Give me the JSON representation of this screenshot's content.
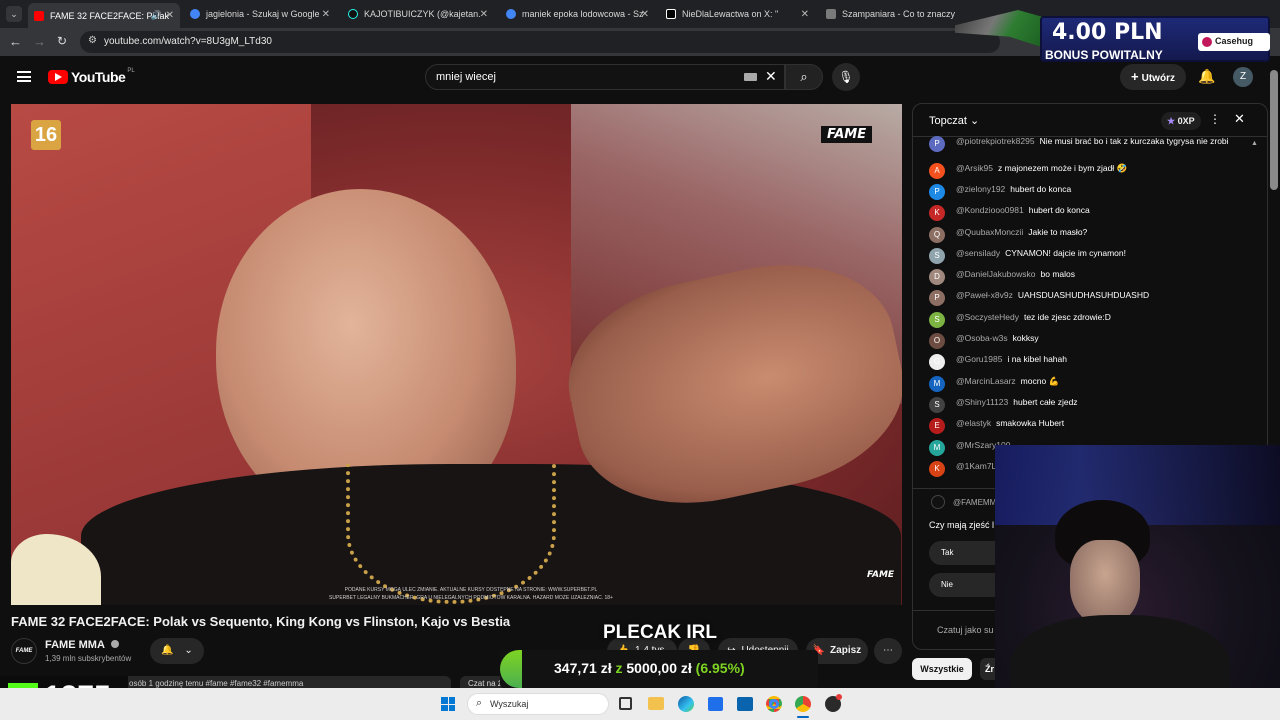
{
  "browser": {
    "tabs": [
      {
        "label": "FAME 32 FACE2FACE: Polak",
        "color": "#ff0000"
      },
      {
        "label": "jagielonia - Szukaj w Google",
        "color": "#4285f4"
      },
      {
        "label": "KAJOTIBUICZYK (@kajetan.szczz",
        "color": "#111111"
      },
      {
        "label": "maniek epoka lodowcowa - Sz",
        "color": "#4285f4"
      },
      {
        "label": "NieDlaLewactwa on X: \"",
        "color": "#000000"
      },
      {
        "label": "Szampaniara - Co to znaczy? D",
        "color": "#7a7a7a"
      }
    ],
    "url": "youtube.com/watch?v=8U3gM_LTd30"
  },
  "youtube": {
    "logo": "YouTube",
    "logo_region": "PL",
    "search_value": "mniej wiecej",
    "create_label": "Utwórz",
    "avatar_letter": "Z"
  },
  "video": {
    "age_rating": "16",
    "brand": "FAME",
    "brand_small": "FAME",
    "disclaimer": "PODANE KURSY MOGĄ ULEC ZMIANIE. AKTUALNE KURSY DOSTĘPNE NA STRONIE: WWW.SUPERBET.PL",
    "disclaimer2": "SUPERBET LEGALNY BUKMACHER. GRA U NIELEGALNYCH PODMIOTÓW KARALNA. HAZARD MOŻE UZALEŻNIAĆ. 18+",
    "title": "FAME 32 FACE2FACE: Polak vs Sequento, King Kong vs Flinston, Kajo vs Bestia"
  },
  "channel": {
    "name": "FAME MMA",
    "subscribers": "1,39 mln subskrybentów",
    "avatar_text": "FAME",
    "verified": "check-circle"
  },
  "actions": {
    "likes": "1,4 tys.",
    "share": "Udostępnij",
    "save": "Zapisz",
    "more": "⋯"
  },
  "description": {
    "meta": "osób  1 godzinę temu  #fame #fame32 #famemma",
    "chat_btn": "Czat na ż"
  },
  "chat": {
    "title": "Topczat",
    "xp": "0XP",
    "messages": [
      {
        "author": "@piotrekpiotrek8295",
        "text": "Nie musi brać bo i tak z kurczaka tygrysa nie zrobi",
        "avatar": "P",
        "color": "#5c6bc0"
      },
      {
        "author": "@Arsik95",
        "text": "z majonezem może i bym zjadł 🤣",
        "avatar": "A",
        "color": "#f4511e"
      },
      {
        "author": "@zielony192",
        "text": "hubert do konca",
        "avatar": "P",
        "color": "#1e88e5"
      },
      {
        "author": "@Kondziooo0981",
        "text": "hubert do konca",
        "avatar": "K",
        "color": "#c62828"
      },
      {
        "author": "@QuubaxMonczii",
        "text": "Jakie to masło?",
        "avatar": "Q",
        "color": "#8d6e63"
      },
      {
        "author": "@sensilady",
        "text": "CYNAMON! dajcie im cynamon!",
        "avatar": "S",
        "color": "#90a4ae"
      },
      {
        "author": "@DanielJakubowsko",
        "text": "bo malos",
        "avatar": "D",
        "color": "#a1887f"
      },
      {
        "author": "@Paweł-x8v9z",
        "text": "UAHSDUASHUDHASUHDUASHD",
        "avatar": "P",
        "color": "#8d6e63"
      },
      {
        "author": "@SoczysteHedy",
        "text": "tez ide zjesc zdrowie:D",
        "avatar": "S",
        "color": "#7cb342"
      },
      {
        "author": "@Osoba-w3s",
        "text": "kokksy",
        "avatar": "O",
        "color": "#6d4c41"
      },
      {
        "author": "@Goru1985",
        "text": "i na kibel hahah",
        "avatar": "G",
        "color": "#eeeeee"
      },
      {
        "author": "@MarcinLasarz",
        "text": "mocno 💪",
        "avatar": "M",
        "color": "#1565c0"
      },
      {
        "author": "@Shiny11123",
        "text": "hubert całe zjedz",
        "avatar": "S",
        "color": "#424242"
      },
      {
        "author": "@elastyk",
        "text": "smakowka Hubert",
        "avatar": "E",
        "color": "#b71c1c"
      },
      {
        "author": "@MrSzary100",
        "text": "",
        "avatar": "M",
        "color": "#26a69a"
      },
      {
        "author": "@1Kam7L",
        "text": "",
        "avatar": "K",
        "color": "#d84315"
      }
    ],
    "poll_author": "@FAMEMM",
    "poll_question": "Czy mają zjeść l",
    "poll_options": [
      "Tak",
      "Nie"
    ],
    "input_placeholder": "Czatuj jako su",
    "filter_all": "Wszystkie",
    "filter_other": "Źr"
  },
  "overlays": {
    "bonus_amount": "4.00 PLN",
    "bonus_label": "BONUS POWITALNY",
    "bonus_brand": "Casehug",
    "goal_title": "PLECAK IRL",
    "goal_current": "347,71 zł",
    "goal_sep": "z",
    "goal_target": "5000,00 zł",
    "goal_percent": "(6.95%)",
    "goal_fraction": 0.0695,
    "kick_count": "1275",
    "kick_logo": "K"
  },
  "taskbar": {
    "search_label": "Wyszukaj"
  }
}
